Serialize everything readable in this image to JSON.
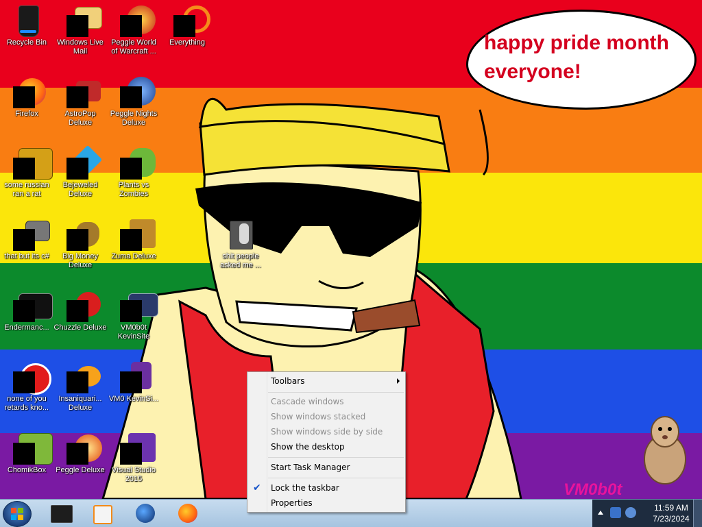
{
  "speech_bubble": {
    "text": "happy pride month everyone!"
  },
  "watermark": "VM0b0t",
  "desktop_icons": [
    {
      "label": "Recycle Bin"
    },
    {
      "label": "Windows Live Mail"
    },
    {
      "label": "Peggle World of Warcraft ..."
    },
    {
      "label": "Everything"
    },
    {
      "label": "Firefox"
    },
    {
      "label": "AstroPop Deluxe"
    },
    {
      "label": "Peggle Nights Deluxe"
    },
    {
      "label": "some russian ran a rat"
    },
    {
      "label": "Bejeweled Deluxe"
    },
    {
      "label": "Plants vs Zombies"
    },
    {
      "label": "that but its c#"
    },
    {
      "label": "Big Money Deluxe"
    },
    {
      "label": "Zuma Deluxe"
    },
    {
      "label": "Endermanc..."
    },
    {
      "label": "Chuzzle Deluxe"
    },
    {
      "label": "VM0b0t KevinSite"
    },
    {
      "label": "none of you retards kno..."
    },
    {
      "label": "Insaniquari... Deluxe"
    },
    {
      "label": "VM0 KevinSi..."
    },
    {
      "label": "ChomikBox"
    },
    {
      "label": "Peggle Deluxe"
    },
    {
      "label": "Visual Studio 2015"
    },
    {
      "label": "shit people asked me ..."
    }
  ],
  "context_menu": {
    "toolbars": "Toolbars",
    "cascade": "Cascade windows",
    "stacked": "Show windows stacked",
    "side_by_side": "Show windows side by side",
    "show_desktop": "Show the desktop",
    "task_manager": "Start Task Manager",
    "lock_taskbar": "Lock the taskbar",
    "properties": "Properties"
  },
  "taskbar": {
    "time": "11:59 AM",
    "date": "7/23/2024",
    "pinned": [
      "terminal-icon",
      "media-player-icon",
      "globe-icon",
      "firefox-icon"
    ]
  },
  "colors": {
    "red": "#e9001c",
    "orange": "#f97d12",
    "yellow": "#fbe60b",
    "green": "#0c8a2c",
    "blue": "#1e4fe6",
    "purple": "#7a1aa3"
  }
}
